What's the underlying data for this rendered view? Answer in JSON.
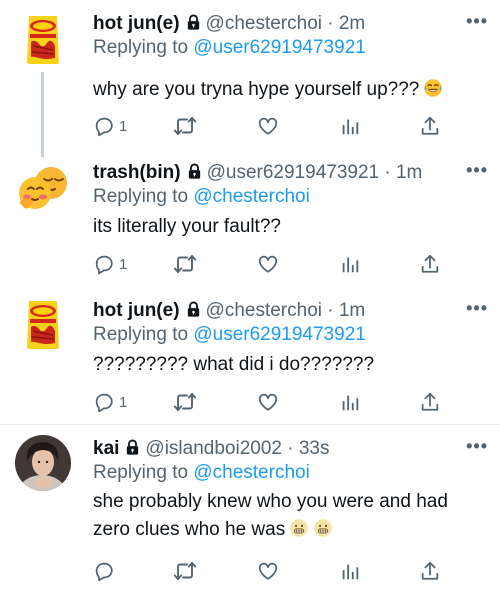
{
  "tweets": [
    {
      "name": "hot jun(e)",
      "handle": "@chesterchoi · 2m",
      "replying_prefix": "Replying to ",
      "replying_to": "@user62919473921",
      "text": "why are you tryna hype yourself up???",
      "emojis": [
        "joy-emoji"
      ],
      "reply_count": "1",
      "avatar": "hot-cheetos-bag"
    },
    {
      "name": "trash(bin)",
      "handle": "@user62919473921 · 1m",
      "replying_prefix": "Replying to ",
      "replying_to": "@chesterchoi",
      "text": "its literally your fault??",
      "emojis": [],
      "reply_count": "1",
      "avatar": "two-faces-emoji"
    },
    {
      "name": "hot jun(e)",
      "handle": "@chesterchoi · 1m",
      "replying_prefix": "Replying to ",
      "replying_to": "@user62919473921",
      "text": "????????? what did i do???????",
      "emojis": [],
      "reply_count": "1",
      "avatar": "hot-cheetos-bag"
    },
    {
      "name": "kai",
      "handle": "@islandboi2002 · 33s",
      "replying_prefix": "Replying to ",
      "replying_to": "@chesterchoi",
      "text": "she probably knew who you were and had zero clues who he was",
      "emojis": [
        "grimace-emoji",
        "grimace-emoji"
      ],
      "reply_count": "",
      "avatar": "person-photo"
    }
  ],
  "icons": {
    "more": "more-options-icon",
    "reply": "reply-icon",
    "retweet": "retweet-icon",
    "like": "like-icon",
    "analytics": "analytics-icon",
    "share": "share-icon",
    "lock": "lock-icon"
  },
  "colors": {
    "link": "#1d9bf0",
    "secondary": "#536471",
    "primary": "#0f1419",
    "thread_line": "#c4cfd6",
    "divider": "#e6ecf0"
  }
}
